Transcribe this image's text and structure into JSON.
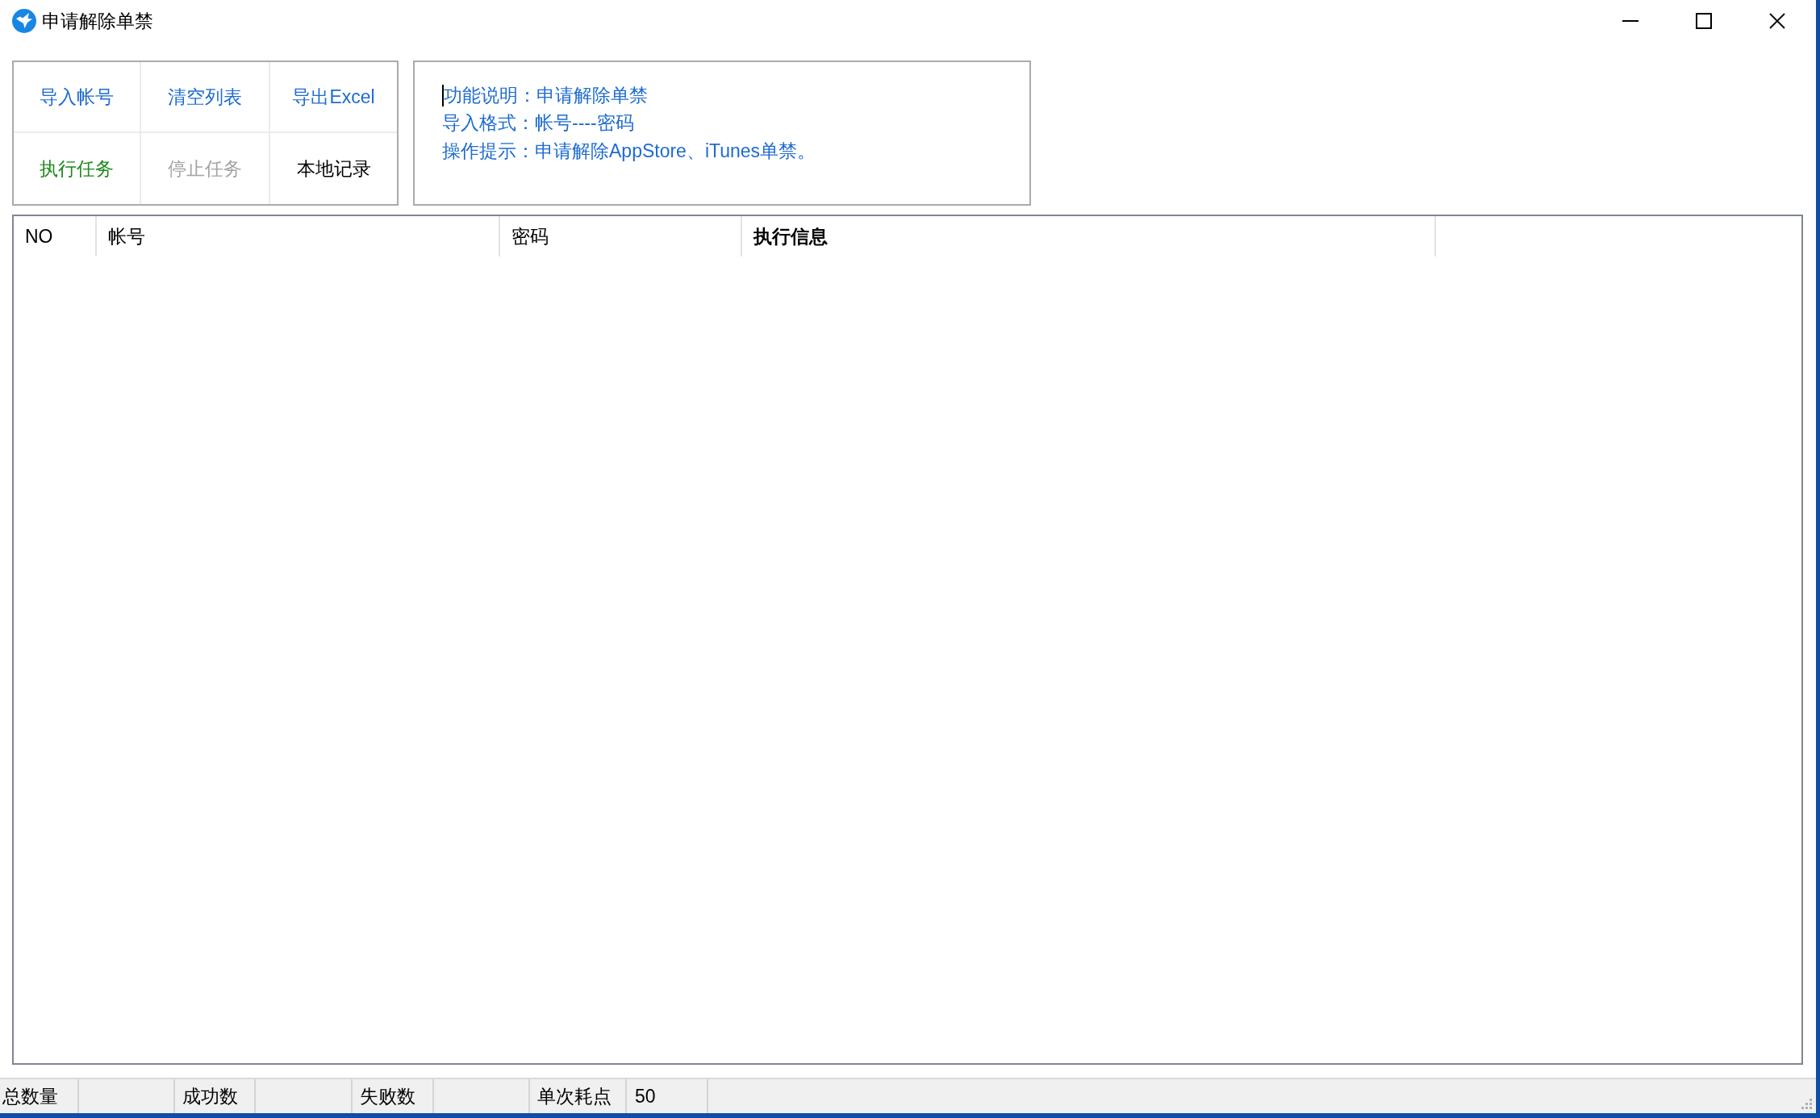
{
  "window": {
    "title": "申请解除单禁"
  },
  "toolbar": {
    "buttons": [
      {
        "label": "导入帐号",
        "color": "#1e6bd1",
        "disabled": false
      },
      {
        "label": "清空列表",
        "color": "#1e6bd1",
        "disabled": false
      },
      {
        "label": "导出Excel",
        "color": "#1e6bd1",
        "disabled": false
      },
      {
        "label": "执行任务",
        "color": "#1c8a1c",
        "disabled": false
      },
      {
        "label": "停止任务",
        "disabled": true
      },
      {
        "label": "本地记录",
        "color": "#000000",
        "disabled": false
      }
    ]
  },
  "info": {
    "focused": true,
    "lines": [
      "功能说明：申请解除单禁",
      "导入格式：帐号----密码",
      "操作提示：申请解除AppStore、iTunes单禁。"
    ]
  },
  "table": {
    "columns": [
      {
        "label": "NO",
        "bold": false
      },
      {
        "label": "帐号",
        "bold": false
      },
      {
        "label": "密码",
        "bold": false
      },
      {
        "label": "执行信息",
        "bold": true
      }
    ]
  },
  "status_bar": {
    "items": [
      {
        "label": "总数量"
      },
      {
        "label": "成功数"
      },
      {
        "label": "失败数"
      },
      {
        "label": "单次耗点",
        "value": "50"
      }
    ]
  }
}
